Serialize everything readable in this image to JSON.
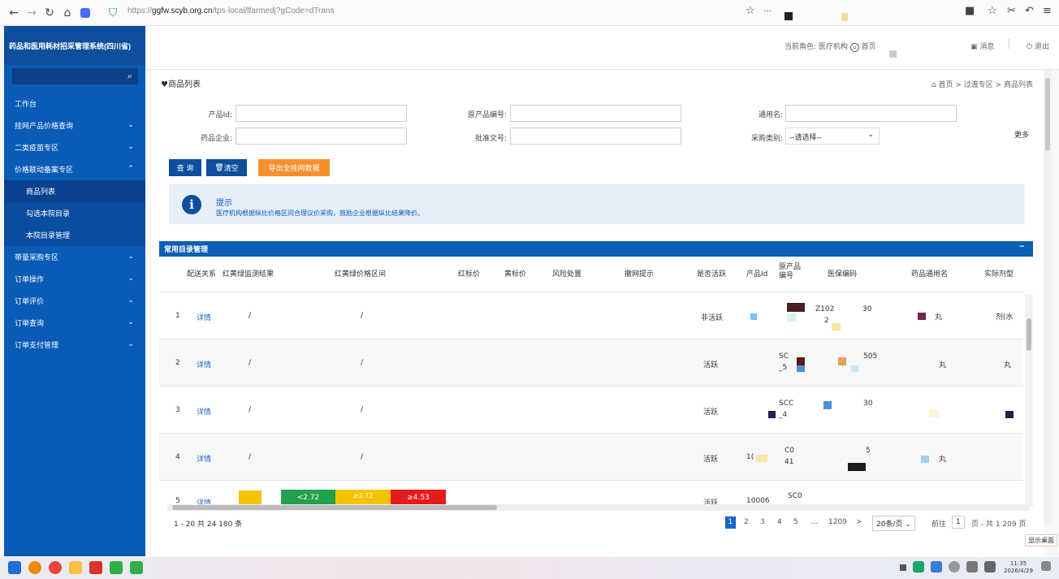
{
  "browser": {
    "url_prefix": "https://",
    "url_domain": "ggfw.scyb.org.cn",
    "url_path": "/tps-local/lfarmedj?gCode=dTrans"
  },
  "sidebar": {
    "system_title": "药品和医用耗材招采管理系统(四川省)",
    "items": [
      {
        "label": "工作台",
        "chevron": ""
      },
      {
        "label": "挂网产品价格查询",
        "chevron": "⌄"
      },
      {
        "label": "二类疫苗专区",
        "chevron": "⌄"
      },
      {
        "label": "价格联动备案专区",
        "chevron": "⌃"
      },
      {
        "label": "商品列表",
        "chevron": ""
      },
      {
        "label": "勾选本院目录",
        "chevron": ""
      },
      {
        "label": "本院目录管理",
        "chevron": ""
      },
      {
        "label": "带量采购专区",
        "chevron": "⌄"
      },
      {
        "label": "订单操作",
        "chevron": "⌄"
      },
      {
        "label": "订单评价",
        "chevron": "⌄"
      },
      {
        "label": "订单查询",
        "chevron": "⌄"
      },
      {
        "label": "订单支付管理",
        "chevron": "⌄"
      }
    ]
  },
  "header": {
    "role": "当前角色: 医疗机构",
    "home": "首页",
    "messages": "消息",
    "logout": "退出"
  },
  "page": {
    "title": "商品列表",
    "breadcrumb": "首页 > 过渡专区 > 商品列表"
  },
  "filters": {
    "product_id_label": "产品Id:",
    "original_code_label": "原产品编号:",
    "generic_name_label": "通用名:",
    "company_label": "药品企业:",
    "approval_label": "批准文号:",
    "purchase_type_label": "采购类别:",
    "purchase_type_value": "--请选择--",
    "more": "更多"
  },
  "buttons": {
    "query": "查 询",
    "clear": "清空",
    "export": "导出全挂网数据"
  },
  "tip": {
    "title": "提示",
    "text": "医疗机构根据纵比价格区间合理议价采购，鼓励企业根据纵比结果降价。"
  },
  "panel": {
    "title": "常用目录管理",
    "minimize": "−"
  },
  "table": {
    "headers": [
      "配送关系",
      "红黄绿监测结果",
      "红黄绿价格区间",
      "红标价",
      "黄标价",
      "风险处置",
      "撤网提示",
      "是否活跃",
      "产品Id",
      "原产品编号",
      "医保编码",
      "药品通用名",
      "实际剂型"
    ],
    "rows": [
      {
        "num": "1",
        "detail": "详情",
        "monitor": "/",
        "range": "/",
        "active": "非活跃",
        "pid": "",
        "code_a": "Z102",
        "code_b": "2",
        "code_c": "30",
        "generic": "丸",
        "form": "剂(水"
      },
      {
        "num": "2",
        "detail": "详情",
        "monitor": "/",
        "range": "/",
        "active": "活跃",
        "pid": "",
        "code_a": "SC",
        "code_b": "_5",
        "code_c": "505",
        "generic": "丸",
        "form": "丸"
      },
      {
        "num": "3",
        "detail": "详情",
        "monitor": "/",
        "range": "/",
        "active": "活跃",
        "pid": "",
        "code_a": "SCC",
        "code_b": "_4",
        "code_c": "30",
        "generic": "",
        "form": ""
      },
      {
        "num": "4",
        "detail": "详情",
        "monitor": "/",
        "range": "/",
        "active": "活跃",
        "pid": "1(",
        "code_a": "C0",
        "code_b": "41",
        "code_c": "5",
        "generic": "丸",
        "form": ""
      },
      {
        "num": "5",
        "detail": "详情",
        "monitor": "",
        "range_green": "<2.72",
        "range_yellow": "≥2.72",
        "range_red": "≥4.53",
        "active": "活跃",
        "pid": "10006",
        "code_a": "SC0",
        "generic": "",
        "form": ""
      }
    ]
  },
  "pagination": {
    "total": "1 - 20  共 24 180 条",
    "pages": [
      "1",
      "2",
      "3",
      "4",
      "5",
      "...",
      "1209",
      ">"
    ],
    "page_size": "20条/页",
    "goto_label": "前往",
    "goto_value": "1",
    "page_total": "页 - 共 1 209 页"
  },
  "desktop_tip": "显示桌面",
  "clock": {
    "time": "11:35",
    "date": "2026/4/29"
  }
}
